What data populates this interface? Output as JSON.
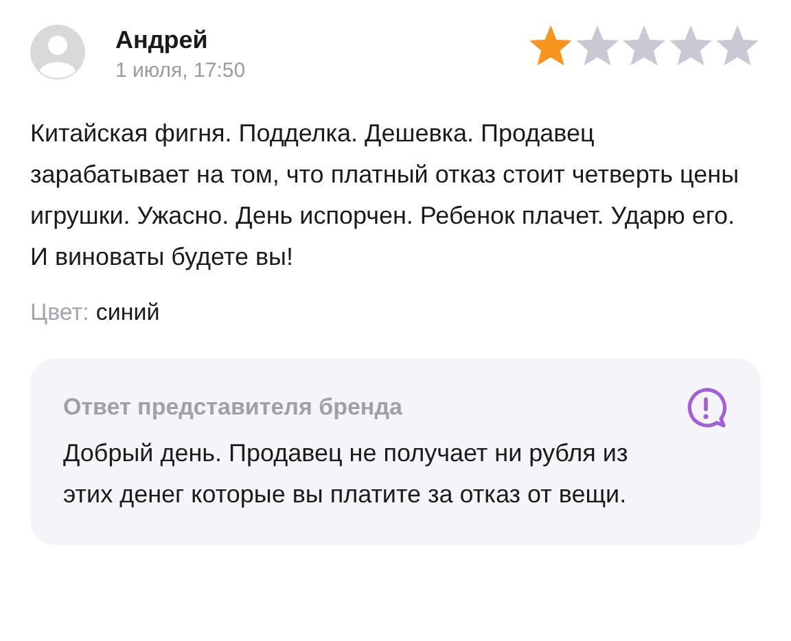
{
  "review": {
    "author": "Андрей",
    "date": "1 июля, 17:50",
    "stars": 1,
    "text": "Китайская фигня. Подделка. Дешевка. Продавец зарабатывает на том, что платный отказ стоит четверть цены игрушки. Ужасно. День испорчен. Ребенок плачет. Ударю его. И виноваты будете вы!",
    "attribute": {
      "label": "Цвет:",
      "value": "синий"
    }
  },
  "brand_reply": {
    "title": "Ответ представителя бренда",
    "text": "Добрый день. Продавец не получает ни рубля из этих денег которые вы платите за отказ от вещи."
  }
}
